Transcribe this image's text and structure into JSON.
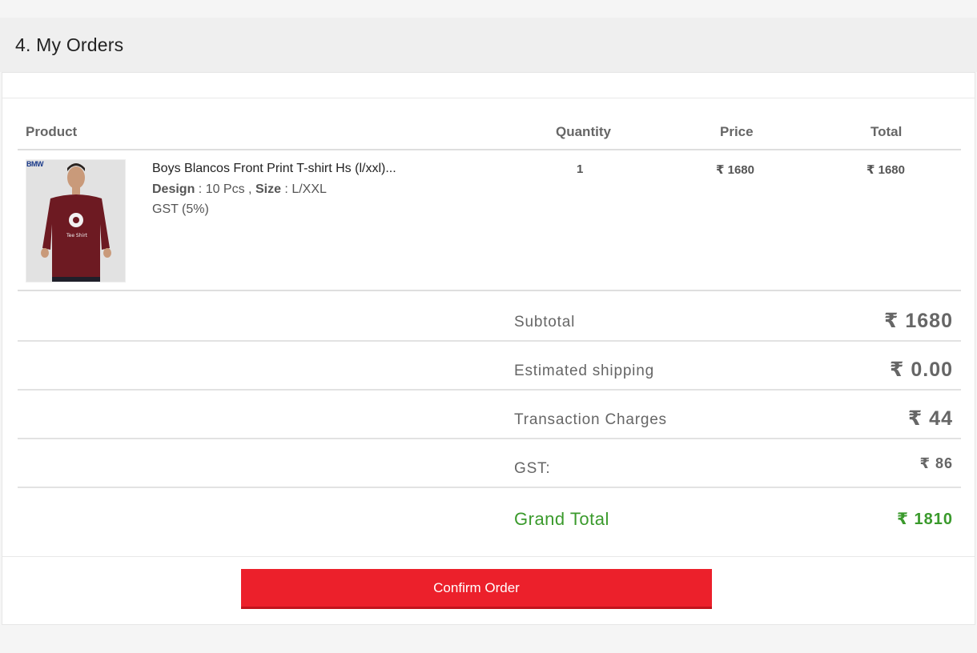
{
  "section": {
    "title": "4. My Orders"
  },
  "table": {
    "headers": {
      "product": "Product",
      "quantity": "Quantity",
      "price": "Price",
      "total": "Total"
    },
    "items": [
      {
        "name": "Boys Blancos Front Print T-shirt Hs (l/xxl)...",
        "design_label": "Design",
        "design_value": "10 Pcs",
        "size_label": "Size",
        "size_value": "L/XXL",
        "gst": "GST (5%)",
        "quantity": "1",
        "price": "₹ 1680",
        "total": "₹ 1680",
        "thumbnail_brand": "BMW",
        "thumbnail_icon": "tshirt-product-image"
      }
    ]
  },
  "summary": {
    "subtotal": {
      "label": "Subtotal",
      "value": "₹ 1680"
    },
    "shipping": {
      "label": "Estimated shipping",
      "value": "₹ 0.00"
    },
    "transaction": {
      "label": "Transaction Charges",
      "value": "₹ 44"
    },
    "gst": {
      "label": "GST:",
      "value": "₹ 86"
    },
    "grand_total": {
      "label": "Grand Total",
      "value": "₹ 1810"
    }
  },
  "actions": {
    "confirm_label": "Confirm Order"
  },
  "colors": {
    "accent_red": "#ec202b",
    "grand_total_green": "#3a9a2c",
    "header_bg": "#efefef"
  }
}
